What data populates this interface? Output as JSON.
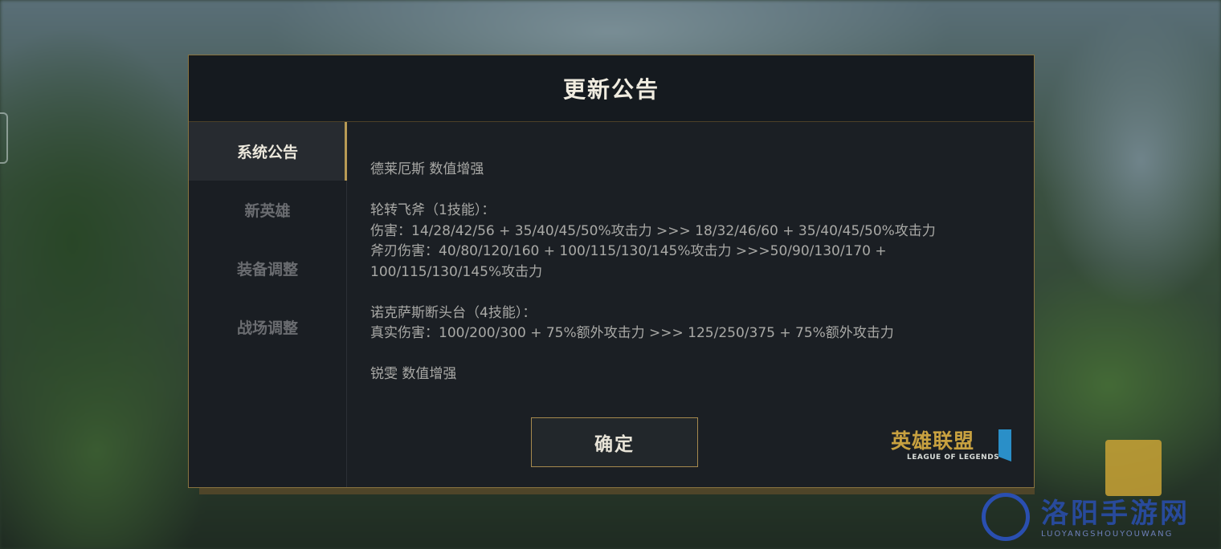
{
  "dialog": {
    "title": "更新公告",
    "confirm_label": "确定"
  },
  "sidebar": {
    "tabs": [
      {
        "label": "系统公告",
        "active": true
      },
      {
        "label": "新英雄",
        "active": false
      },
      {
        "label": "装备调整",
        "active": false
      },
      {
        "label": "战场调整",
        "active": false
      }
    ]
  },
  "content": {
    "lines": [
      "德莱厄斯  数值增强",
      "轮转飞斧（1技能）：",
      "伤害：14/28/42/56 + 35/40/45/50%攻击力 >>> 18/32/46/60 + 35/40/45/50%攻击力",
      "斧刃伤害：40/80/120/160 + 100/115/130/145%攻击力 >>>50/90/130/170 + 100/115/130/145%攻击力",
      "诺克萨斯断头台（4技能）：",
      "真实伤害：100/200/300 + 75%额外攻击力 >>> 125/250/375 + 75%额外攻击力",
      "锐雯  数值增强"
    ]
  },
  "logo": {
    "cn": "英雄联盟",
    "en": "LEAGUE OF LEGENDS"
  },
  "watermark": {
    "text": "洛阳手游网",
    "sub": "LUOYANGSHOUYOUWANG"
  },
  "colors": {
    "accent_gold": "#b89a55",
    "panel_bg": "#1b1f24",
    "text_body": "#a9a9a6",
    "watermark_blue": "#2a4fb0"
  }
}
